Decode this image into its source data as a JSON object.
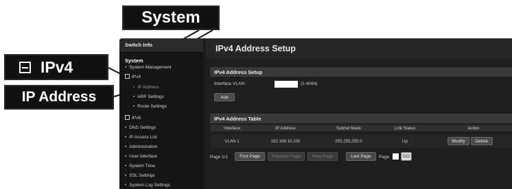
{
  "callouts": {
    "system": "System",
    "ipv4": "IPv4",
    "ip_address": "IP Address"
  },
  "sidebar": {
    "header": "Switch Info",
    "section": "System",
    "items": [
      {
        "label": "System Management"
      },
      {
        "label": "IPv4"
      },
      {
        "label": "IP Address"
      },
      {
        "label": "ARP Settings"
      },
      {
        "label": "Route Settings"
      },
      {
        "label": "IPv6"
      },
      {
        "label": "DNS Settings"
      },
      {
        "label": "IP Access List"
      },
      {
        "label": "Administration"
      },
      {
        "label": "User Interface"
      },
      {
        "label": "System Time"
      },
      {
        "label": "SSL Settings"
      },
      {
        "label": "System Log Settings"
      }
    ]
  },
  "main": {
    "title": "IPv4 Address Setup",
    "setup": {
      "heading": "IPv4 Address Setup",
      "vlan_label": "Interface VLAN :",
      "vlan_range": "(1-4094)",
      "add_label": "Add"
    },
    "table": {
      "heading": "IPv4 Address Table",
      "columns": [
        "Interface",
        "IP Address",
        "Subnet Mask",
        "Link Status",
        "Action"
      ],
      "rows": [
        {
          "interface": "VLAN 1",
          "ip": "192.168.10.200",
          "mask": "255.255.255.0",
          "status": "Up",
          "modify": "Modify",
          "delete": "Delete"
        }
      ]
    },
    "pager": {
      "page_text": "Page 1/1",
      "first": "First Page",
      "previous": "Previous Page",
      "next": "Next Page",
      "last": "Last Page",
      "page_label": "Page",
      "go": "GO"
    }
  },
  "colors": {
    "background": "#1b1b1b",
    "header_bar": "#3a3a3a",
    "callout": "#111111"
  }
}
